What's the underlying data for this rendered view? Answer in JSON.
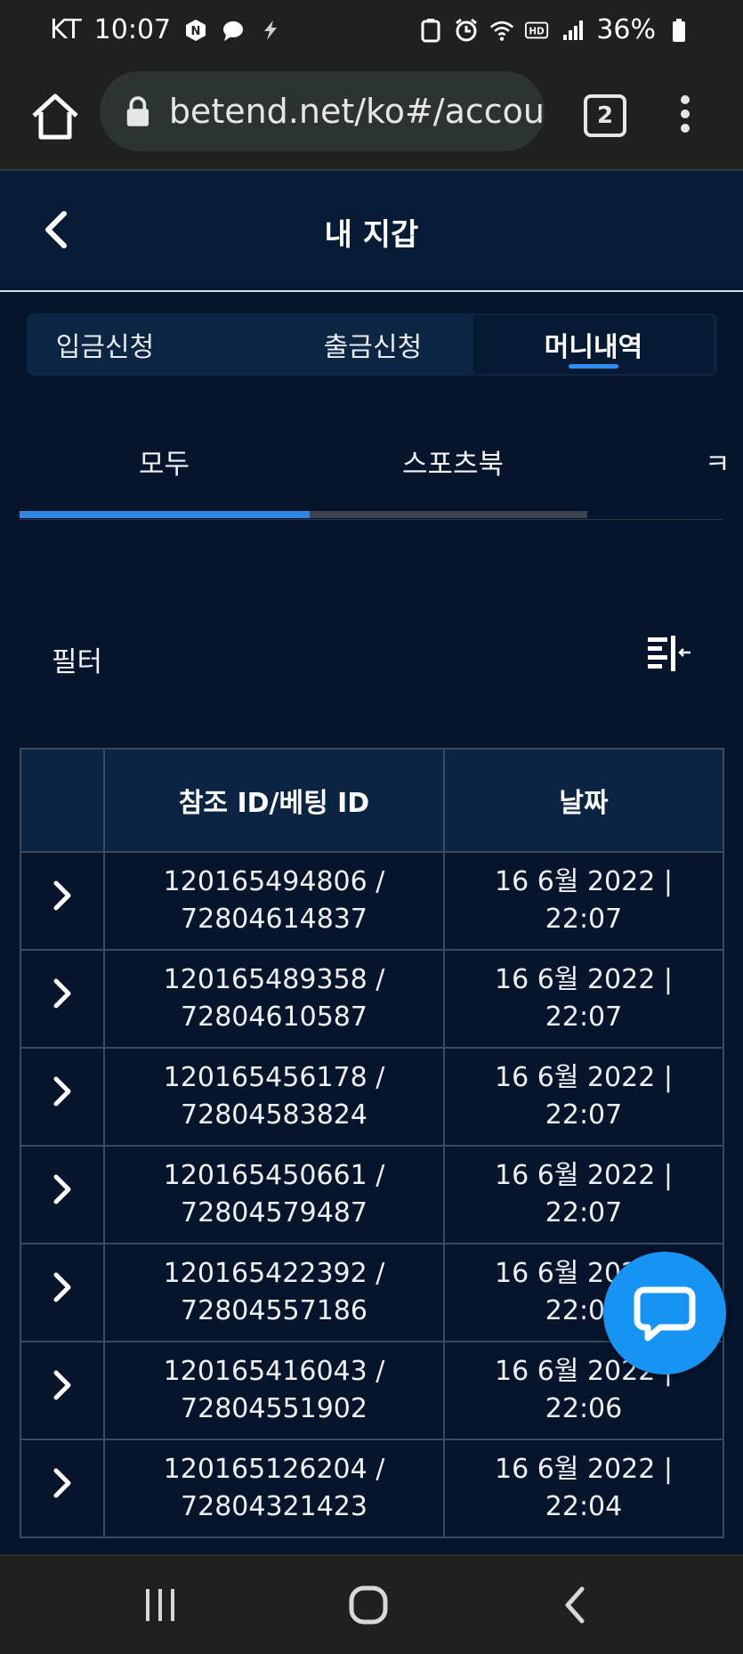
{
  "status_bar": {
    "carrier": "KT",
    "time": "10:07",
    "battery": "36%"
  },
  "browser": {
    "url": "betend.net/ko#/accou",
    "tab_count": "2"
  },
  "header": {
    "title": "내 지갑"
  },
  "segments": [
    {
      "label": "입금신청"
    },
    {
      "label": "출금신청"
    },
    {
      "label": "머니내역",
      "active": true
    }
  ],
  "subtabs": [
    {
      "label": "모두",
      "active": true
    },
    {
      "label": "스포츠북"
    },
    {
      "label": "ㅋ"
    }
  ],
  "filter": {
    "label": "필터"
  },
  "table": {
    "headers": [
      "",
      "참조 ID/베팅 ID",
      "날짜"
    ],
    "rows": [
      {
        "ref": "120165494806 /",
        "bet": "72804614837",
        "date": "16 6월 2022 |",
        "time": "22:07"
      },
      {
        "ref": "120165489358 /",
        "bet": "72804610587",
        "date": "16 6월 2022 |",
        "time": "22:07"
      },
      {
        "ref": "120165456178 /",
        "bet": "72804583824",
        "date": "16 6월 2022 |",
        "time": "22:07"
      },
      {
        "ref": "120165450661 /",
        "bet": "72804579487",
        "date": "16 6월 2022 |",
        "time": "22:07"
      },
      {
        "ref": "120165422392 /",
        "bet": "72804557186",
        "date": "16 6월 2022 |",
        "time": "22:07"
      },
      {
        "ref": "120165416043 /",
        "bet": "72804551902",
        "date": "16 6월 2022 |",
        "time": "22:06"
      },
      {
        "ref": "120165126204 /",
        "bet": "72804321423",
        "date": "16 6월 2022 |",
        "time": "22:04"
      }
    ]
  },
  "colors": {
    "background": "#06152b",
    "accent": "#2f86e6",
    "chat": "#1594f4"
  }
}
